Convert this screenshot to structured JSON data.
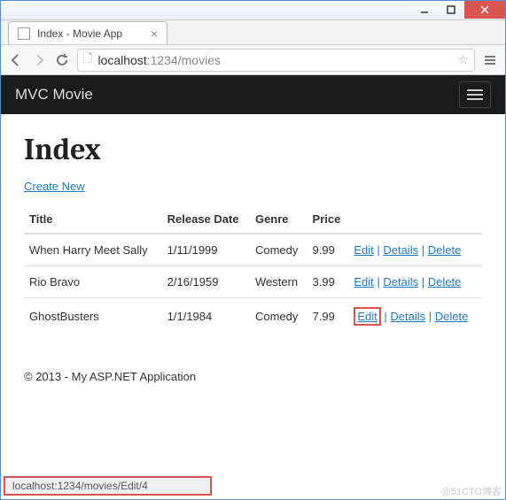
{
  "window": {
    "tab_title": "Index - Movie App"
  },
  "urlbar": {
    "protocol_icon": "page-icon",
    "host": "localhost",
    "port_path": ":1234/movies"
  },
  "navbar": {
    "brand": "MVC Movie"
  },
  "page": {
    "heading": "Index",
    "create_link": "Create New",
    "columns": [
      "Title",
      "Release Date",
      "Genre",
      "Price",
      ""
    ],
    "rows": [
      {
        "title": "When Harry Meet Sally",
        "date": "1/11/1999",
        "genre": "Comedy",
        "price": "9.99",
        "edit": "Edit",
        "details": "Details",
        "delete": "Delete",
        "highlight": false
      },
      {
        "title": "Rio Bravo",
        "date": "2/16/1959",
        "genre": "Western",
        "price": "3.99",
        "edit": "Edit",
        "details": "Details",
        "delete": "Delete",
        "highlight": false
      },
      {
        "title": "GhostBusters",
        "date": "1/1/1984",
        "genre": "Comedy",
        "price": "7.99",
        "edit": "Edit",
        "details": "Details",
        "delete": "Delete",
        "highlight": true
      }
    ],
    "footer": "© 2013 - My ASP.NET Application"
  },
  "statusbar": {
    "text": "localhost:1234/movies/Edit/4"
  },
  "watermark": "@51CTO博客"
}
